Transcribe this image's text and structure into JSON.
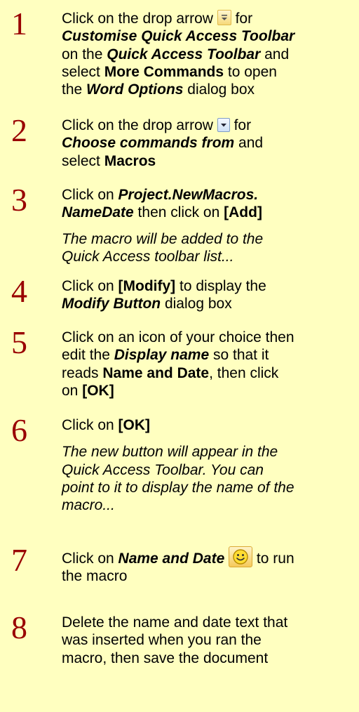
{
  "steps": [
    {
      "number": "1",
      "l1_pre": "Click on the drop arrow ",
      "l1_post": " for",
      "l2": "Customise Quick Access Toolbar",
      "l3_pre": "on the ",
      "l3_bi": "Quick Access Toolbar",
      "l3_post": " and",
      "l4_pre": "select ",
      "l4_b": "More Commands",
      "l4_post": " to open",
      "l5_pre": "the ",
      "l5_bi": "Word Options",
      "l5_post": " dialog box",
      "icon": "qat-dropdown-arrow-icon"
    },
    {
      "number": "2",
      "l1_pre": "Click on the drop arrow ",
      "l1_post": " for",
      "l2_bi": "Choose commands from",
      "l2_post": " and",
      "l3_pre": "select ",
      "l3_b": "Macros",
      "icon": "dropdown-arrow-icon"
    },
    {
      "number": "3",
      "l1_pre": "Click on ",
      "l1_bi": "Project.NewMacros.",
      "l2_bi": "NameDate",
      "l2_mid": " then click on ",
      "l2_b": "[Add]",
      "note_1": "The macro will be added to the",
      "note_2": "Quick Access toolbar list..."
    },
    {
      "number": "4",
      "l1_pre": "Click on ",
      "l1_b": "[Modify]",
      "l1_post": " to display the",
      "l2_bi": "Modify Button",
      "l2_post": " dialog box"
    },
    {
      "number": "5",
      "l1": "Click on an icon of your choice then",
      "l2_pre": "edit the ",
      "l2_bi": "Display name",
      "l2_post": " so that it",
      "l3_pre": "reads ",
      "l3_b": "Name and Date",
      "l3_post": ", then click",
      "l4_pre": "on ",
      "l4_b": "[OK]"
    },
    {
      "number": "6",
      "l1_pre": "Click on ",
      "l1_b": "[OK]",
      "note_1": "The new button will appear in the",
      "note_2": "Quick Access Toolbar. You can",
      "note_3": "point to it to display the name of the",
      "note_4": "macro..."
    },
    {
      "number": "7",
      "l1_pre": "Click on ",
      "l1_bi": "Name and Date",
      "l1_post": " to run",
      "l2": "the macro",
      "icon": "smiley-face-icon"
    },
    {
      "number": "8",
      "l1": "Delete the name and date text that",
      "l2": "was inserted when you ran the",
      "l3": "macro, then save the document"
    }
  ],
  "colors": {
    "background": "#FFFFC0",
    "step_number": "#990000",
    "text": "#000000"
  }
}
